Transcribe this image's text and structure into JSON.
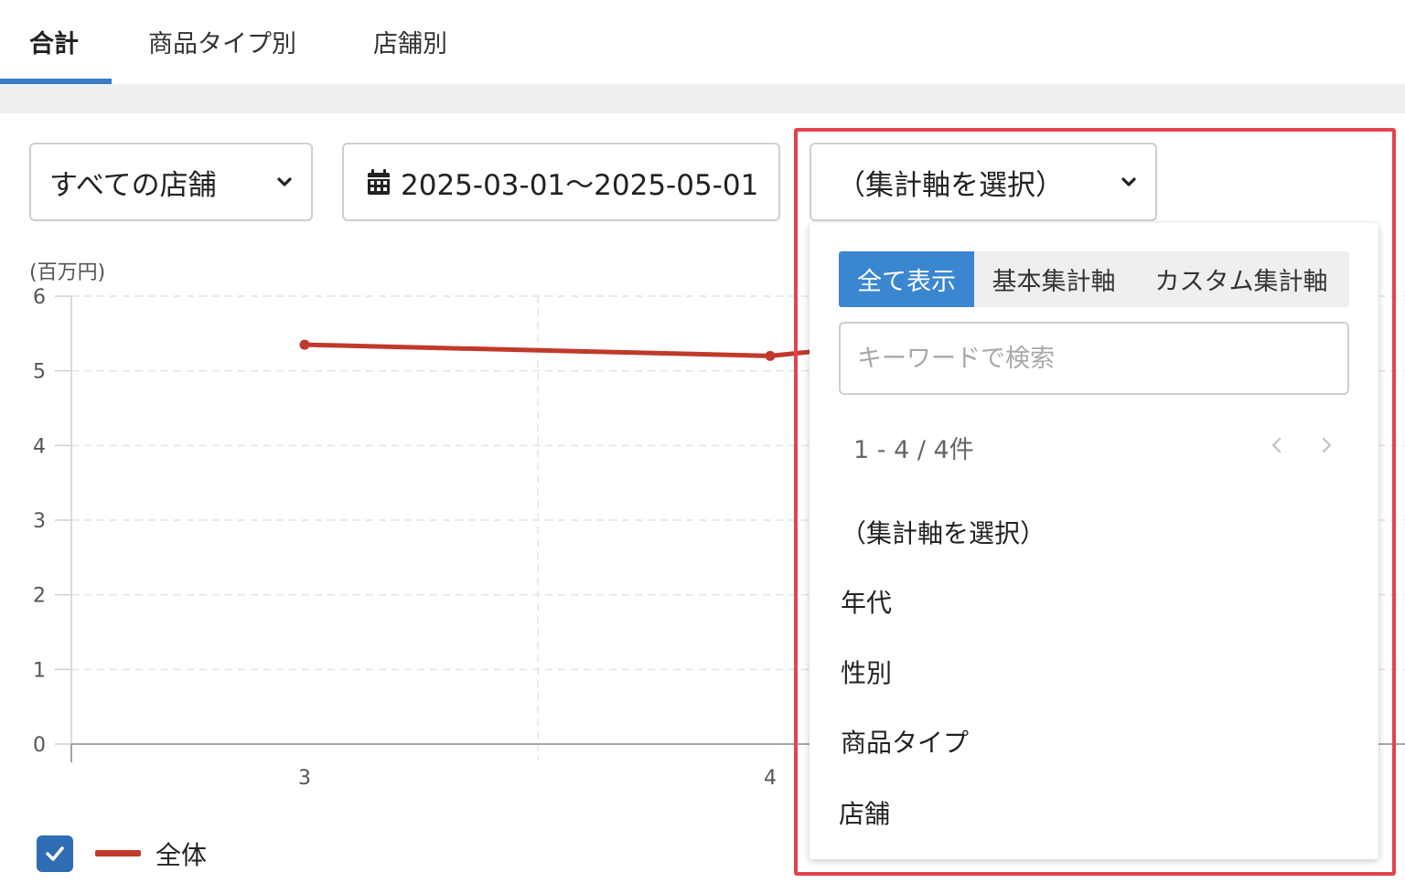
{
  "tabs": [
    {
      "label": "合計",
      "active": true
    },
    {
      "label": "商品タイプ別",
      "active": false
    },
    {
      "label": "店舗別",
      "active": false
    }
  ],
  "filters": {
    "store": "すべての店舗",
    "date_range": "2025-03-01〜2025-05-01",
    "axis": "（集計軸を選択）"
  },
  "chart": {
    "unit_label": "(百万円)",
    "legend_label": "全体",
    "legend_checked": true
  },
  "chart_data": {
    "type": "line",
    "x": [
      3,
      4
    ],
    "y_unit": "(百万円)",
    "ylim": [
      0,
      6
    ],
    "yticks": [
      "0",
      "1",
      "2",
      "3",
      "4",
      "5",
      "6"
    ],
    "xticks": [
      "3",
      "4"
    ],
    "series": [
      {
        "name": "全体",
        "values": [
          5.35,
          5.2
        ],
        "color": "#c0392b"
      }
    ],
    "grid": true,
    "legend": "bottom-left"
  },
  "dropdown": {
    "segments": [
      "全て表示",
      "基本集計軸",
      "カスタム集計軸"
    ],
    "active_segment": "全て表示",
    "search_placeholder": "キーワードで検索",
    "pager_text": "1 - 4 / 4件",
    "options": [
      "（集計軸を選択）",
      "年代",
      "性別",
      "商品タイプ",
      "店舗"
    ]
  },
  "colors": {
    "accent": "#3a86d1",
    "line": "#c0392b",
    "highlight": "#e3434f"
  }
}
